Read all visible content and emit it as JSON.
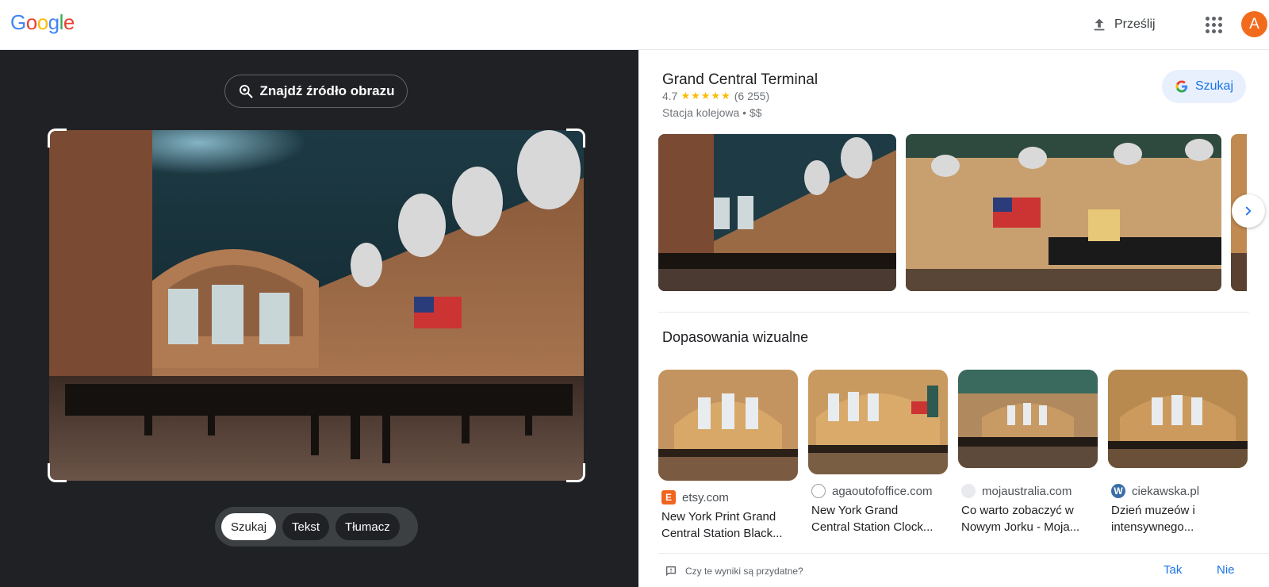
{
  "header": {
    "logo_letters": [
      {
        "ch": "G",
        "color": "#4285f4"
      },
      {
        "ch": "o",
        "color": "#ea4335"
      },
      {
        "ch": "o",
        "color": "#fbbc05"
      },
      {
        "ch": "g",
        "color": "#4285f4"
      },
      {
        "ch": "l",
        "color": "#34a853"
      },
      {
        "ch": "e",
        "color": "#ea4335"
      }
    ],
    "upload_label": "Prześlij",
    "upload_icon": "upload-icon",
    "apps_icon": "apps-grid-icon",
    "avatar_letter": "A",
    "avatar_color": "#f26b1d"
  },
  "left_panel": {
    "find_source_label": "Znajdź źródło obrazu",
    "find_source_icon": "lens-search-icon",
    "modes": [
      {
        "label": "Szukaj",
        "active": true
      },
      {
        "label": "Tekst",
        "active": false
      },
      {
        "label": "Tłumacz",
        "active": false
      }
    ]
  },
  "result": {
    "title": "Grand Central Terminal",
    "rating": "4.7",
    "stars": "★★★★★",
    "review_count": "(6 255)",
    "category": "Stacja kolejowa • $$",
    "search_button_label": "Szukaj",
    "carousel_next_icon": "chevron-right-icon"
  },
  "visual_matches": {
    "title": "Dopasowania wizualne",
    "items": [
      {
        "source": "etsy.com",
        "favicon_letter": "E",
        "favicon_color": "#f1641e",
        "title_line1": "New York Print Grand",
        "title_line2": "Central Station Black..."
      },
      {
        "source": "agaoutofoffice.com",
        "favicon_letter": "",
        "favicon_color": "#ffffff",
        "title_line1": "New York Grand",
        "title_line2": "Central Station Clock..."
      },
      {
        "source": "mojaustralia.com",
        "favicon_letter": "",
        "favicon_color": "#9aa0a6",
        "title_line1": "Co warto zobaczyć w",
        "title_line2": "Nowym Jorku - Moja..."
      },
      {
        "source": "ciekawska.pl",
        "favicon_letter": "W",
        "favicon_color": "#3b6ea8",
        "title_line1": "Dzień muzeów i",
        "title_line2": "intensywnego..."
      }
    ]
  },
  "feedback": {
    "question": "Czy te wyniki są przydatne?",
    "yes": "Tak",
    "no": "Nie"
  }
}
